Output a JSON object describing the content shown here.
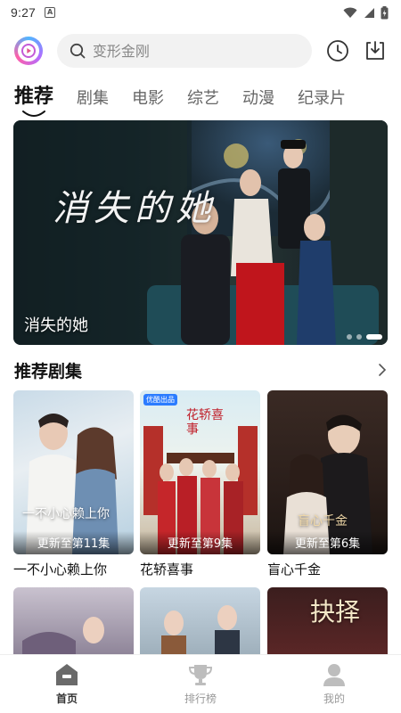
{
  "status_bar": {
    "time": "9:27",
    "notification_icon": "A"
  },
  "header": {
    "logo": "app-logo",
    "search": {
      "placeholder": "变形金刚"
    },
    "icons": [
      "history-icon",
      "download-icon"
    ]
  },
  "tabs": [
    {
      "label": "推荐",
      "active": true
    },
    {
      "label": "剧集",
      "active": false
    },
    {
      "label": "电影",
      "active": false
    },
    {
      "label": "综艺",
      "active": false
    },
    {
      "label": "动漫",
      "active": false
    },
    {
      "label": "纪录片",
      "active": false
    }
  ],
  "banner": {
    "art_title": "消失的她",
    "caption": "消失的她",
    "dots": 3,
    "active_dot": 3
  },
  "section": {
    "title": "推荐剧集",
    "cards": [
      {
        "title": "一不小心赖上你",
        "badge": "更新至第11集",
        "poster_text": "一不小心赖上你"
      },
      {
        "title": "花轿喜事",
        "badge": "更新至第9集",
        "poster_text": "花轿喜事",
        "tag": "优酷出品"
      },
      {
        "title": "盲心千金",
        "badge": "更新至第6集",
        "poster_text": "盲心千金"
      }
    ],
    "row2_poster_text": [
      "",
      "",
      "抉择"
    ]
  },
  "bottom_nav": [
    {
      "label": "首页",
      "active": true
    },
    {
      "label": "排行榜",
      "active": false
    },
    {
      "label": "我的",
      "active": false
    }
  ],
  "colors": {
    "accent": "#111111",
    "inactive": "#999999",
    "search_bg": "#f2f2f2"
  }
}
